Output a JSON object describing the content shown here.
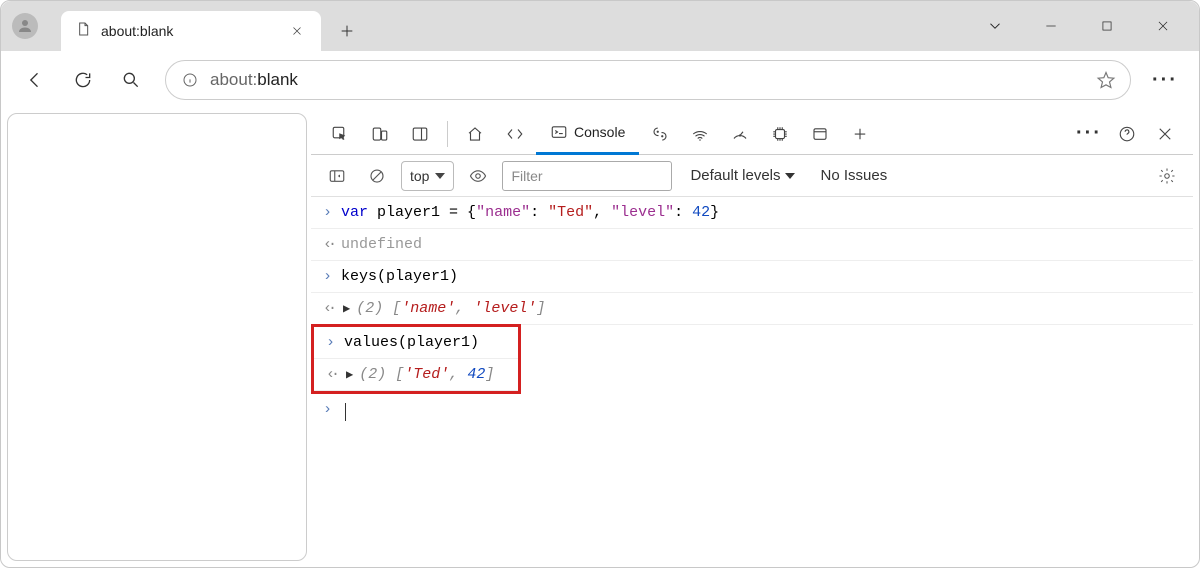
{
  "browser": {
    "tab_title": "about:blank",
    "address_prefix": "about:",
    "address_page": "blank"
  },
  "devtools": {
    "active_tab": "Console",
    "console_toolbar": {
      "context": "top",
      "filter_placeholder": "Filter",
      "levels": "Default levels",
      "issues": "No Issues"
    },
    "entries": [
      {
        "type": "input",
        "code_html": "<span class='kw'>var</span> <span class='ident'>player1</span> = {<span class='prop'>\"name\"</span>: <span class='str'>\"Ted\"</span>, <span class='prop'>\"level\"</span>: <span class='num'>42</span>}"
      },
      {
        "type": "result",
        "code_html": "<span class='undef'>undefined</span>"
      },
      {
        "type": "input",
        "code_html": "<span class='ident'>keys(player1)</span>"
      },
      {
        "type": "result_array",
        "len": "(2)",
        "items_html": "[<span class='arr-str'>'name'</span>, <span class='arr-str'>'level'</span>]"
      },
      {
        "type": "input",
        "code_html": "<span class='ident'>values(player1)</span>",
        "highlighted": true
      },
      {
        "type": "result_array",
        "len": "(2)",
        "items_html": "[<span class='arr-str'>'Ted'</span>, <span class='arr-num'>42</span>]",
        "highlighted": true
      }
    ]
  }
}
